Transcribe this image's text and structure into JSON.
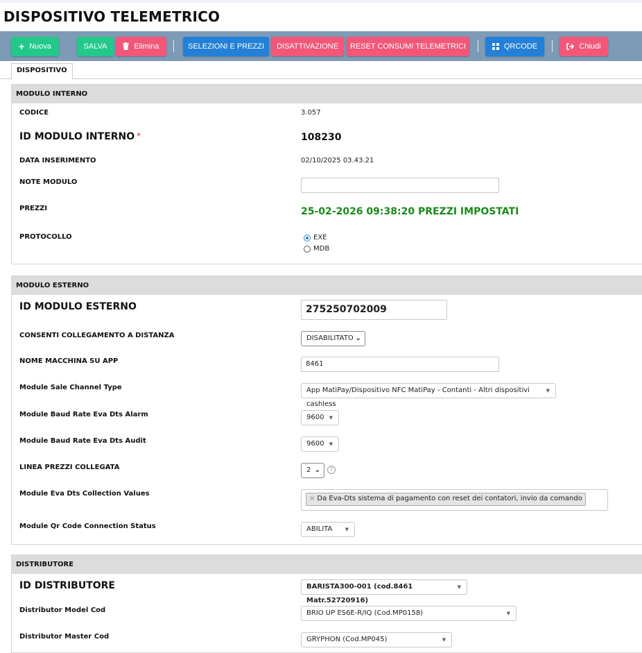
{
  "title": "DISPOSITIVO TELEMETRICO",
  "toolbar": {
    "nuova": "Nuova",
    "salva": "SALVA",
    "elimina": "Elimina",
    "selezioni": "SELEZIONI E PREZZI",
    "disattivazione": "DISATTIVAZIONE",
    "reset": "RESET CONSUMI TELEMETRICI",
    "qrcode": "QRCODE",
    "chiudi": "Chiudi"
  },
  "tabs": [
    "DISPOSITIVO"
  ],
  "modulo_interno": {
    "header": "MODULO INTERNO",
    "codice_label": "CODICE",
    "codice_value": "3.057",
    "id_label": "ID MODULO INTERNO",
    "required_mark": "*",
    "id_value": "108230",
    "data_label": "DATA INSERIMENTO",
    "data_value": "02/10/2025 03.43.21",
    "note_label": "NOTE MODULO",
    "note_value": "",
    "prezzi_label": "PREZZI",
    "prezzi_value": "25-02-2026 09:38:20 PREZZI IMPOSTATI",
    "protocollo_label": "PROTOCOLLO",
    "protocollo_options": [
      "EXE",
      "MDB"
    ],
    "protocollo_selected": "EXE"
  },
  "modulo_esterno": {
    "header": "MODULO ESTERNO",
    "id_label": "ID MODULO ESTERNO",
    "id_value": "275250702009",
    "consenti_label": "CONSENTI COLLEGAMENTO A DISTANZA",
    "consenti_value": "DISABILITATO",
    "nome_label": "NOME MACCHINA SU APP",
    "nome_value": "8461",
    "sale_label": "Module Sale Channel Type",
    "sale_value": "App MatiPay/Dispositivo NFC MatiPay - Contanti - Altri dispositivi cashless",
    "baud_alarm_label": "Module Baud Rate Eva Dts Alarm",
    "baud_alarm_value": "9600",
    "baud_audit_label": "Module Baud Rate Eva Dts Audit",
    "baud_audit_value": "9600",
    "linea_label": "LINEA PREZZI COLLEGATA",
    "linea_value": "2",
    "help_glyph": "?",
    "collection_label": "Module Eva Dts Collection Values",
    "collection_chip": "Da Eva-Dts sistema di pagamento con reset dei contatori, invio da comando",
    "chip_remove": "×",
    "qr_label": "Module Qr Code Connection Status",
    "qr_value": "ABILITA"
  },
  "distributore": {
    "header": "DISTRIBUTORE",
    "id_label": "ID DISTRIBUTORE",
    "id_value": "BARISTA300-001 (cod.8461 Matr.52720916)",
    "model_label": "Distributor Model Cod",
    "model_value": "BRIO UP ES6E-R/IQ (Cod.MP0158)",
    "master_label": "Distributor Master Cod",
    "master_value": "GRYPHON (Cod.MP045)"
  },
  "colors": {
    "toolbar_bg": "#7d9bb6",
    "green": "#22c98b",
    "red": "#f2577a",
    "blue": "#2380d6",
    "price_text": "#1a8a1a"
  },
  "icons": {
    "nuova": "plus-icon",
    "elimina": "trash-icon",
    "qrcode": "grid-icon",
    "chiudi": "sign-out-icon"
  }
}
